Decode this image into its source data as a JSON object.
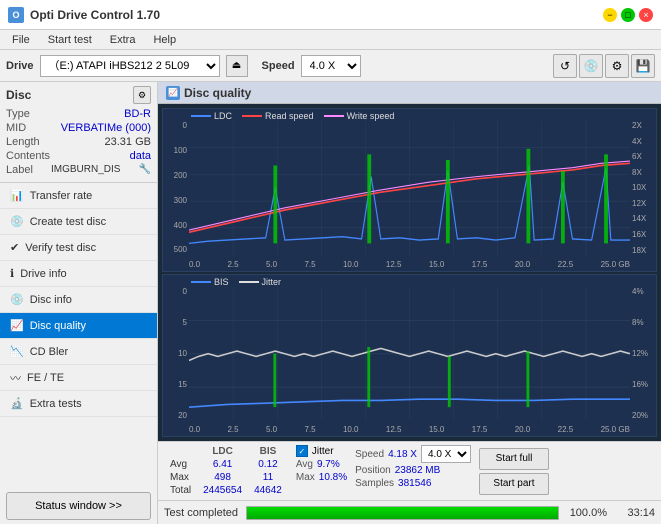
{
  "app": {
    "title": "Opti Drive Control 1.70",
    "icon": "O"
  },
  "titlebar": {
    "minimize": "−",
    "maximize": "□",
    "close": "×"
  },
  "menu": {
    "items": [
      "File",
      "Start test",
      "Extra",
      "Help"
    ]
  },
  "drive_toolbar": {
    "drive_label": "Drive",
    "drive_value": "(E:)  ATAPI iHBS212  2 5L09",
    "speed_label": "Speed",
    "speed_value": "4.0 X"
  },
  "sidebar": {
    "disc_title": "Disc",
    "disc_props": [
      {
        "label": "Type",
        "value": "BD-R"
      },
      {
        "label": "MID",
        "value": "VERBATIMe (000)"
      },
      {
        "label": "Length",
        "value": "23.31 GB"
      },
      {
        "label": "Contents",
        "value": "data"
      },
      {
        "label": "Label",
        "value": "IMGBURN_DIS"
      }
    ],
    "nav_items": [
      {
        "id": "transfer-rate",
        "label": "Transfer rate",
        "active": false
      },
      {
        "id": "create-test-disc",
        "label": "Create test disc",
        "active": false
      },
      {
        "id": "verify-test-disc",
        "label": "Verify test disc",
        "active": false
      },
      {
        "id": "drive-info",
        "label": "Drive info",
        "active": false
      },
      {
        "id": "disc-info",
        "label": "Disc info",
        "active": false
      },
      {
        "id": "disc-quality",
        "label": "Disc quality",
        "active": true
      },
      {
        "id": "cd-bler",
        "label": "CD Bler",
        "active": false
      },
      {
        "id": "fe-te",
        "label": "FE / TE",
        "active": false
      },
      {
        "id": "extra-tests",
        "label": "Extra tests",
        "active": false
      }
    ],
    "status_btn": "Status window >>"
  },
  "disc_quality": {
    "title": "Disc quality",
    "chart1": {
      "legend": [
        {
          "label": "LDC",
          "color": "#4488ff"
        },
        {
          "label": "Read speed",
          "color": "#ff4444"
        },
        {
          "label": "Write speed",
          "color": "#ff88ff"
        }
      ],
      "y_axis_left": [
        "0",
        "100",
        "200",
        "300",
        "400",
        "500"
      ],
      "y_axis_right": [
        "2X",
        "4X",
        "6X",
        "8X",
        "10X",
        "12X",
        "14X",
        "16X",
        "18X"
      ],
      "x_axis": [
        "0.0",
        "2.5",
        "5.0",
        "7.5",
        "10.0",
        "12.5",
        "15.0",
        "17.5",
        "20.0",
        "22.5",
        "25.0 GB"
      ]
    },
    "chart2": {
      "legend": [
        {
          "label": "BIS",
          "color": "#4488ff"
        },
        {
          "label": "Jitter",
          "color": "#dddddd"
        }
      ],
      "y_axis_left": [
        "0",
        "5",
        "10",
        "15",
        "20"
      ],
      "y_axis_right": [
        "4%",
        "8%",
        "12%",
        "16%",
        "20%"
      ],
      "x_axis": [
        "0.0",
        "2.5",
        "5.0",
        "7.5",
        "10.0",
        "12.5",
        "15.0",
        "17.5",
        "20.0",
        "22.5",
        "25.0 GB"
      ]
    }
  },
  "stats": {
    "headers": [
      "LDC",
      "BIS"
    ],
    "rows": [
      {
        "label": "Avg",
        "ldc": "6.41",
        "bis": "0.12"
      },
      {
        "label": "Max",
        "ldc": "498",
        "bis": "11"
      },
      {
        "label": "Total",
        "ldc": "2445654",
        "bis": "44642"
      }
    ],
    "jitter": {
      "label": "Jitter",
      "avg": "9.7%",
      "max": "10.8%"
    },
    "speed": {
      "label": "Speed",
      "value": "4.18 X",
      "select": "4.0 X",
      "position_label": "Position",
      "position_value": "23862 MB",
      "samples_label": "Samples",
      "samples_value": "381546"
    },
    "buttons": {
      "start_full": "Start full",
      "start_part": "Start part"
    }
  },
  "status_bar": {
    "text": "Test completed",
    "progress": 100,
    "progress_text": "100.0%",
    "time": "33:14"
  }
}
